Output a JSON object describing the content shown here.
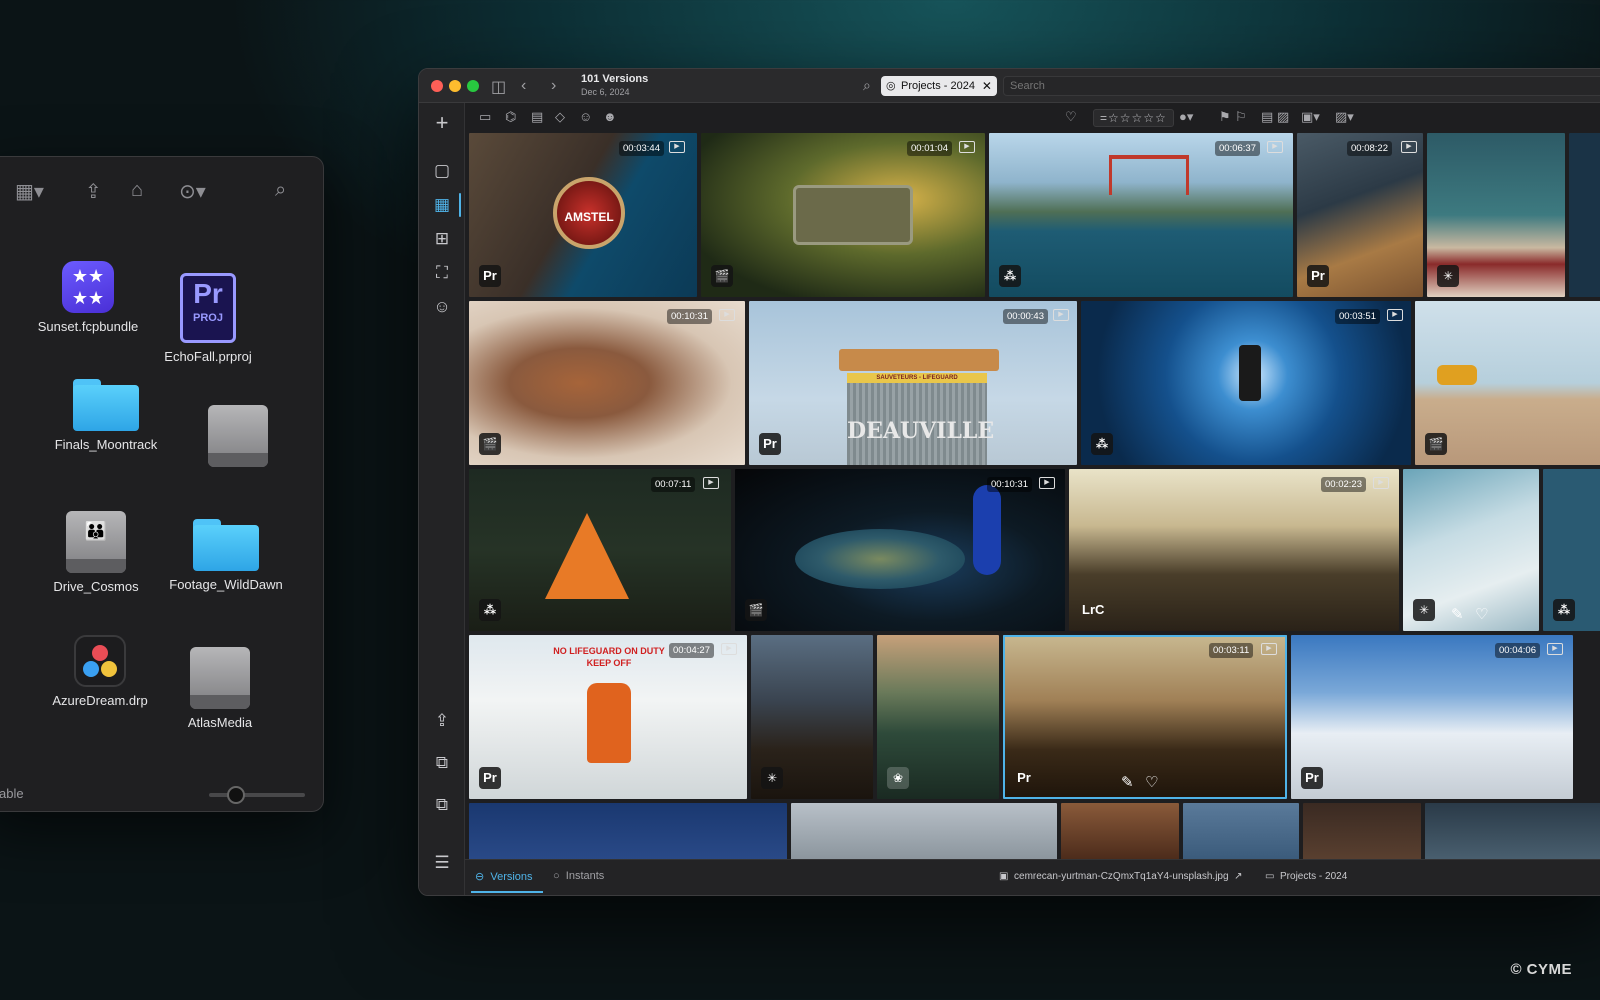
{
  "finder": {
    "toolbar_icons": [
      "view-grid-icon",
      "share-icon",
      "tag-icon",
      "more-icon",
      "search-icon"
    ],
    "items": [
      {
        "label": "Sunset.fcpbundle",
        "icon": "fcp-bundle-icon"
      },
      {
        "label": "EchoFall.prproj",
        "icon": "premiere-project-icon",
        "icon_big": "Pr",
        "icon_small": "PROJ"
      },
      {
        "label": "Finals_Moontrack",
        "icon": "folder-icon"
      },
      {
        "label": "",
        "icon": "drive-icon"
      },
      {
        "label": "Drive_Cosmos",
        "icon": "network-drive-icon"
      },
      {
        "label": "Footage_WildDawn",
        "icon": "folder-icon"
      },
      {
        "label": "AzureDream.drp",
        "icon": "davinci-resolve-icon"
      },
      {
        "label": "AtlasMedia",
        "icon": "drive-icon"
      }
    ],
    "status": "able"
  },
  "app": {
    "title": "101 Versions",
    "subtitle": "Dec 6, 2024",
    "search_token": "Projects - 2024",
    "search_placeholder": "Search",
    "rating_stars": "=☆☆☆☆☆",
    "tabs": [
      {
        "label": "Versions",
        "active": true
      },
      {
        "label": "Instants",
        "active": false
      }
    ],
    "status_file": "cemrecan-yurtman-CzQmxTq1aY4-unsplash.jpg",
    "status_project": "Projects - 2024",
    "accent": "#4fb3e8",
    "tiles": [
      {
        "duration": "00:03:44",
        "badge": "Pr"
      },
      {
        "duration": "00:01:04",
        "badge": "🎬"
      },
      {
        "duration": "00:06:37",
        "badge": "resolve"
      },
      {
        "duration": "00:08:22",
        "badge": "Pr"
      },
      {
        "duration": "",
        "badge": "✳"
      },
      {
        "duration": "00:10:31",
        "badge": "🎬"
      },
      {
        "duration": "00:00:43",
        "badge": "Pr",
        "sign_text": "DEAUVILLE",
        "sign_sub": "SAUVETEURS - LIFEGUARD"
      },
      {
        "duration": "00:03:51",
        "badge": "resolve"
      },
      {
        "duration": "",
        "badge": "🎬"
      },
      {
        "duration": "00:07:11",
        "badge": "resolve"
      },
      {
        "duration": "00:10:31",
        "badge": "🎬"
      },
      {
        "duration": "00:02:23",
        "badge": "LrC"
      },
      {
        "duration": "",
        "badge": "✳"
      },
      {
        "duration": "",
        "badge": "resolve"
      },
      {
        "duration": "00:04:27",
        "badge": "Pr",
        "sign_text": "NO LIFEGUARD ON DUTY",
        "sign_sub": "KEEP OFF"
      },
      {
        "duration": "",
        "badge": "✳"
      },
      {
        "duration": "",
        "badge": "❀"
      },
      {
        "duration": "00:03:11",
        "badge": "Pr"
      },
      {
        "duration": "00:04:06",
        "badge": "Pr"
      },
      {
        "duration": "",
        "badge": ""
      },
      {
        "duration": "",
        "badge": ""
      },
      {
        "duration": "",
        "badge": ""
      },
      {
        "duration": "",
        "badge": ""
      },
      {
        "duration": "",
        "badge": ""
      },
      {
        "duration": "",
        "badge": ""
      }
    ]
  },
  "watermark": "© CYME"
}
